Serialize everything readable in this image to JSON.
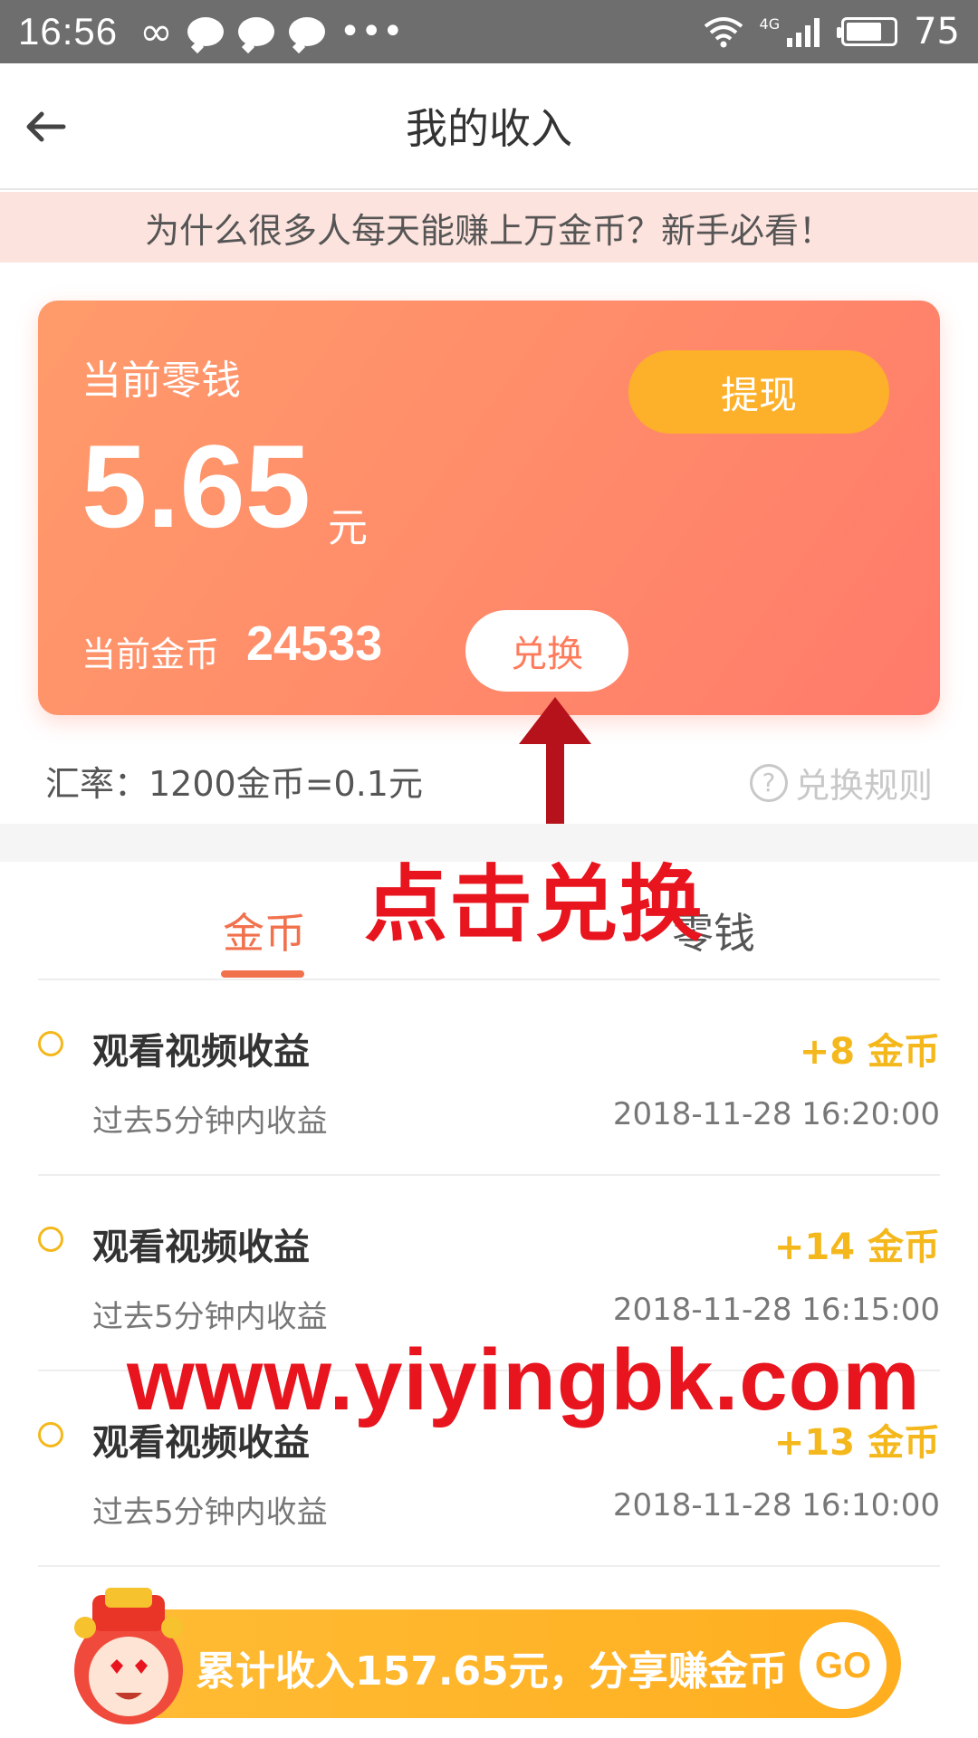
{
  "status_bar": {
    "time": "16:56",
    "battery": "75",
    "network": "4G"
  },
  "header": {
    "title": "我的收入"
  },
  "notice": {
    "text": "为什么很多人每天能赚上万金币？新手必看！"
  },
  "card": {
    "label": "当前零钱",
    "amount": "5.65",
    "unit": "元",
    "withdraw_label": "提现",
    "coins_label": "当前金币",
    "coins_value": "24533",
    "exchange_label": "兑换"
  },
  "rate": {
    "text": "汇率：1200金币=0.1元",
    "rules_label": "兑换规则"
  },
  "annotation": {
    "click_text": "点击兑换",
    "watermark": "www.yiyingbk.com"
  },
  "tabs": [
    {
      "label": "金币"
    },
    {
      "label": "零钱"
    }
  ],
  "records": [
    {
      "title": "观看视频收益",
      "subtitle": "过去5分钟内收益",
      "gain": "+8 金币",
      "time": "2018-11-28 16:20:00"
    },
    {
      "title": "观看视频收益",
      "subtitle": "过去5分钟内收益",
      "gain": "+14 金币",
      "time": "2018-11-28 16:15:00"
    },
    {
      "title": "观看视频收益",
      "subtitle": "过去5分钟内收益",
      "gain": "+13 金币",
      "time": "2018-11-28 16:10:00"
    }
  ],
  "bottom_bar": {
    "text": "累计收入157.65元，分享赚金币",
    "go_label": "GO"
  },
  "colors": {
    "accent": "#f2714d",
    "gold": "#f4b81c",
    "annotation_red": "#e8141e",
    "card_start": "#ff9b6b",
    "card_end": "#ff7a6b"
  }
}
